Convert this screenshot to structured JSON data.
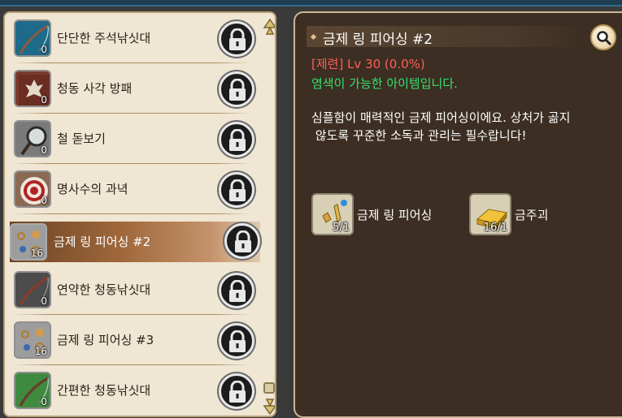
{
  "recipe_list": [
    {
      "label": "단단한 주석낚싯대",
      "count": "0",
      "icon": "fishing-rod-icon",
      "bg": "#1e6a8a",
      "locked": true
    },
    {
      "label": "청동 사각 방패",
      "count": "0",
      "icon": "shield-icon",
      "bg": "#7a3a2c",
      "locked": true
    },
    {
      "label": "철 돋보기",
      "count": "0",
      "icon": "magnifier-icon",
      "bg": "#7a7a7a",
      "locked": true
    },
    {
      "label": "명사수의 과녁",
      "count": "0",
      "icon": "target-icon",
      "bg": "#8a6a55",
      "locked": true
    },
    {
      "label": "금제 링 피어싱 #2",
      "count": "16",
      "icon": "ring-piercing-icon",
      "bg": "#9d9d9d",
      "locked": true,
      "selected": true
    },
    {
      "label": "연약한 청동낚싯대",
      "count": "0",
      "icon": "fishing-rod-icon",
      "bg": "#4c4c4c",
      "locked": true
    },
    {
      "label": "금제 링 피어싱 #3",
      "count": "16",
      "icon": "ring-piercing-icon",
      "bg": "#9d9d9d",
      "locked": true
    },
    {
      "label": "간편한 청동낚싯대",
      "count": "0",
      "icon": "fishing-rod-icon",
      "bg": "#3f8a3f",
      "locked": true
    }
  ],
  "detail": {
    "title": "금제 링 피어싱 #2",
    "level": "[제련] Lv 30 (0.0%)",
    "dye_note": "염색이 가능한 아이템입니다.",
    "description_line1": "심플함이 매력적인 금제 피어싱이에요. 상처가 곪지",
    "description_line2": " 않도록 꾸준한 소독과 관리는 필수랍니다!",
    "materials": [
      {
        "name": "금제 링 피어싱",
        "qty": "5/1",
        "icon": "ring-piercing-icon"
      },
      {
        "name": "금주괴",
        "qty": "16/1",
        "icon": "gold-ingot-icon"
      }
    ]
  },
  "colors": {
    "level_text": "#ff5f58",
    "dye_text": "#35e06c",
    "selected_row": "#a0683c",
    "panel_bg": "#3c2e22",
    "list_bg": "#efe6d3"
  }
}
